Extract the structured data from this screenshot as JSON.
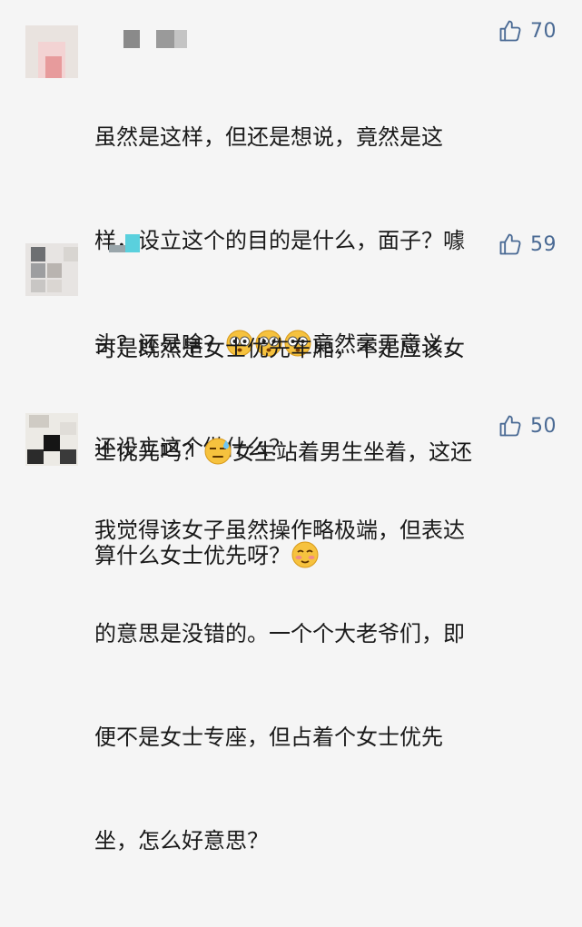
{
  "comments": [
    {
      "likes": "70",
      "line1": "虽然是这样，但还是想说，竟然是这",
      "line2": "样，设立这个的目的是什么，面子？噱",
      "line3a": "头？还是啥？",
      "line3b": "竟然毫无意义，",
      "line4": "还设立这个做什么？",
      "emoji": "shocked-face-icon"
    },
    {
      "likes": "59",
      "line1": "可是既然是女士优先车厢，不是应该女",
      "line2a": "士优先吗？",
      "line2b": "女生站着男生坐着，这还",
      "line3a": "算什么女士优先呀？",
      "emoji1": "sweat-face-icon",
      "emoji2": "blushing-face-icon"
    },
    {
      "likes": "50",
      "line1": "我觉得该女子虽然操作略极端，但表达",
      "line2": "的意思是没错的。一个个大老爷们，即",
      "line3": "便不是女士专座，但占着个女士优先",
      "line4": "坐，怎么好意思？"
    }
  ],
  "colors": {
    "background": "#f5f5f5",
    "like_accent": "#4a6a94",
    "text": "#1a1a1a"
  }
}
